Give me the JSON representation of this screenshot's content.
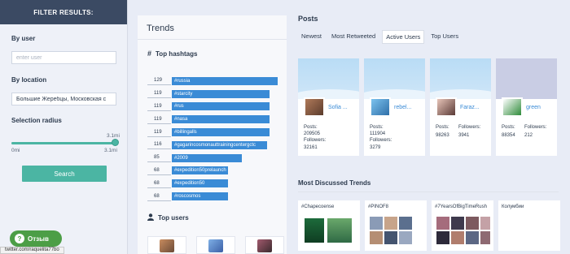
{
  "filter": {
    "header": "FILTER RESULTS:",
    "by_user_label": "By user",
    "user_placeholder": "enter user",
    "by_location_label": "By location",
    "location_value": "Большие Жеребцы, Московская с",
    "radius_label": "Selection radius",
    "radius_value": "3.1mi",
    "radius_min": "0mi",
    "radius_max": "3.1mi",
    "radius_fraction": 1.0,
    "search_label": "Search"
  },
  "trends": {
    "title": "Trends",
    "top_hashtags_label": "Top hashtags",
    "hashtags": [
      {
        "count": "129",
        "tag": "#russia",
        "value": 129
      },
      {
        "count": "119",
        "tag": "#starcity",
        "value": 119
      },
      {
        "count": "119",
        "tag": "#rus",
        "value": 119
      },
      {
        "count": "119",
        "tag": "#nasa",
        "value": 119
      },
      {
        "count": "119",
        "tag": "#billingalls",
        "value": 119
      },
      {
        "count": "116",
        "tag": "#gagarincosmonauttrainingcentergctc",
        "value": 116
      },
      {
        "count": "85",
        "tag": "#2009",
        "value": 85
      },
      {
        "count": "68",
        "tag": "#expedition50prelaunch",
        "value": 68
      },
      {
        "count": "68",
        "tag": "#expedition50",
        "value": 68
      },
      {
        "count": "68",
        "tag": "#roscosmos",
        "value": 68
      }
    ],
    "top_users_label": "Top users"
  },
  "posts": {
    "title": "Posts",
    "tabs": [
      "Newest",
      "Most Retweeted",
      "Active Users",
      "Top Users"
    ],
    "active_tab": 2,
    "posts_label": "Posts:",
    "followers_label": "Followers:",
    "cards": [
      {
        "name": "Sofia ...",
        "posts": "209505",
        "followers": "32161",
        "layout": "stacked"
      },
      {
        "name": "rebel...",
        "posts": "111904",
        "followers": "3279",
        "layout": "stacked"
      },
      {
        "name": "Faraz...",
        "posts": "98263",
        "followers": "3941",
        "layout": "side"
      },
      {
        "name": "green",
        "posts": "88354",
        "followers": "212",
        "layout": "side"
      }
    ],
    "most_discussed_label": "Most Discussed Trends",
    "discussed": [
      "#Chapecoense",
      "#PINOF8",
      "#7YearsOfBigTimeRush",
      "Колумбии"
    ]
  },
  "feedback_label": "Отзыв",
  "status_url": "twitter.com/raquelita77bo",
  "colors": {
    "accent": "#4bb5a3",
    "bar": "#3a8bd6",
    "header": "#3b4a63",
    "feedback": "#4c9e46"
  }
}
